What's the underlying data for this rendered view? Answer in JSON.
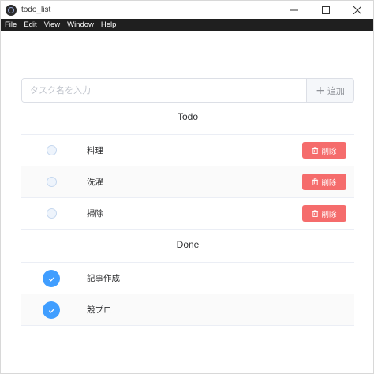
{
  "window": {
    "title": "todo_list",
    "minimize": "minimize-icon",
    "maximize": "maximize-icon",
    "close": "close-icon"
  },
  "menu": [
    "File",
    "Edit",
    "View",
    "Window",
    "Help"
  ],
  "input": {
    "placeholder": "タスク名を入力",
    "value": "",
    "add_label": "追加"
  },
  "todo": {
    "heading": "Todo",
    "delete_label": "削除",
    "items": [
      {
        "label": "料理"
      },
      {
        "label": "洗濯"
      },
      {
        "label": "掃除"
      }
    ]
  },
  "done": {
    "heading": "Done",
    "items": [
      {
        "label": "記事作成"
      },
      {
        "label": "競プロ"
      }
    ]
  },
  "colors": {
    "accent": "#409eff",
    "danger": "#f56c6c",
    "menubar": "#1f1f1f"
  }
}
